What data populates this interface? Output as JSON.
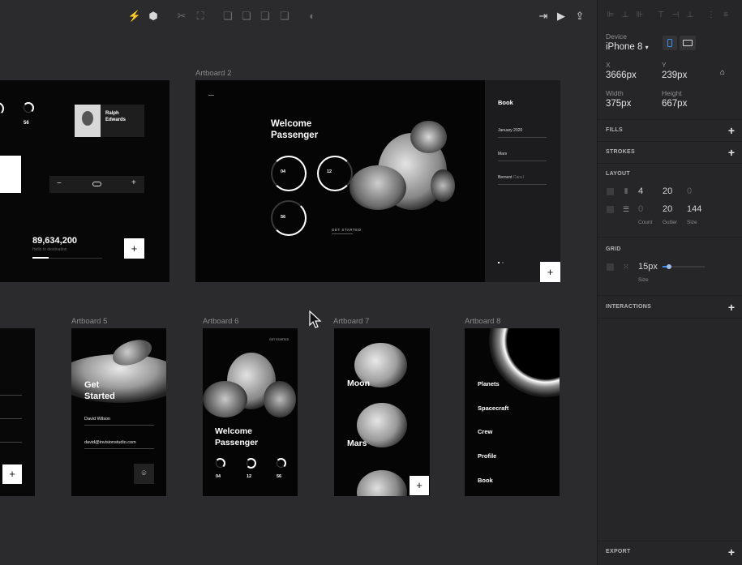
{
  "canvas": {
    "artboards": {
      "a2": {
        "label": "Artboard 2",
        "welcome": "Welcome",
        "passenger": "Passenger",
        "r1": "04",
        "r2": "12",
        "r3": "56",
        "get_started": "GET STARTED",
        "book": "Book",
        "date": "January 2020",
        "dest": "Mars",
        "passenger_name": "Bernent",
        "passenger_class": "Cara I"
      },
      "a1": {
        "name": "Ralph",
        "surname": "Edwards",
        "big": "89,634,200",
        "sub": "Hello to destination",
        "r": "56"
      },
      "a5": {
        "label": "Artboard 5",
        "title1": "Get",
        "title2": "Started",
        "name": "David Wilson",
        "email": "david@invisionstudio.com"
      },
      "a6": {
        "label": "Artboard 6",
        "get_started": "GET STARTED",
        "welcome": "Welcome",
        "passenger": "Passenger",
        "r1": "04",
        "r2": "12",
        "r3": "56"
      },
      "a7": {
        "label": "Artboard 7",
        "moon": "Moon",
        "mars": "Mars"
      },
      "a8": {
        "label": "Artboard 8",
        "items": [
          "Planets",
          "Spacecraft",
          "Crew",
          "Profile",
          "Book"
        ]
      }
    }
  },
  "panel": {
    "device_label": "Device",
    "device_value": "iPhone 8",
    "x_label": "X",
    "x_value": "3666px",
    "y_label": "Y",
    "y_value": "239px",
    "width_label": "Width",
    "width_value": "375px",
    "height_label": "Height",
    "height_value": "667px",
    "fills": "FILLS",
    "strokes": "STROKES",
    "layout": "LAYOUT",
    "layout_row1": {
      "count": "4",
      "gutter": "20",
      "size": "0"
    },
    "layout_row2": {
      "count": "0",
      "gutter": "20",
      "size": "144"
    },
    "count_label": "Count",
    "gutter_label": "Gutter",
    "size_label": "Size",
    "grid": "GRID",
    "grid_value": "15px",
    "grid_size_label": "Size",
    "interactions": "INTERACTIONS",
    "export": "EXPORT"
  }
}
